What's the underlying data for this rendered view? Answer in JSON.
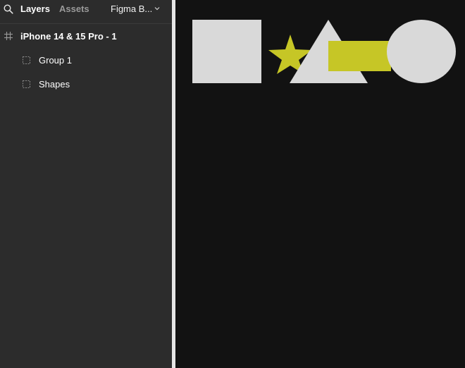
{
  "header": {
    "tabs": [
      {
        "label": "Layers",
        "active": true
      },
      {
        "label": "Assets",
        "active": false
      }
    ],
    "page_selector": "Figma B..."
  },
  "layers": [
    {
      "label": "iPhone 14 & 15 Pro - 1",
      "type": "frame"
    },
    {
      "label": "Group 1",
      "type": "group"
    },
    {
      "label": "Shapes",
      "type": "group"
    }
  ],
  "colors": {
    "panel_bg": "#2c2c2c",
    "canvas_bg": "#121212",
    "shape_gray": "#d9d9d9",
    "shape_accent": "#c6c626"
  },
  "canvas_shapes": [
    {
      "shape": "square",
      "color": "#d9d9d9"
    },
    {
      "shape": "star",
      "color": "#c6c626"
    },
    {
      "shape": "triangle",
      "color": "#d9d9d9"
    },
    {
      "shape": "rectangle",
      "color": "#c6c626"
    },
    {
      "shape": "ellipse",
      "color": "#d9d9d9"
    }
  ]
}
